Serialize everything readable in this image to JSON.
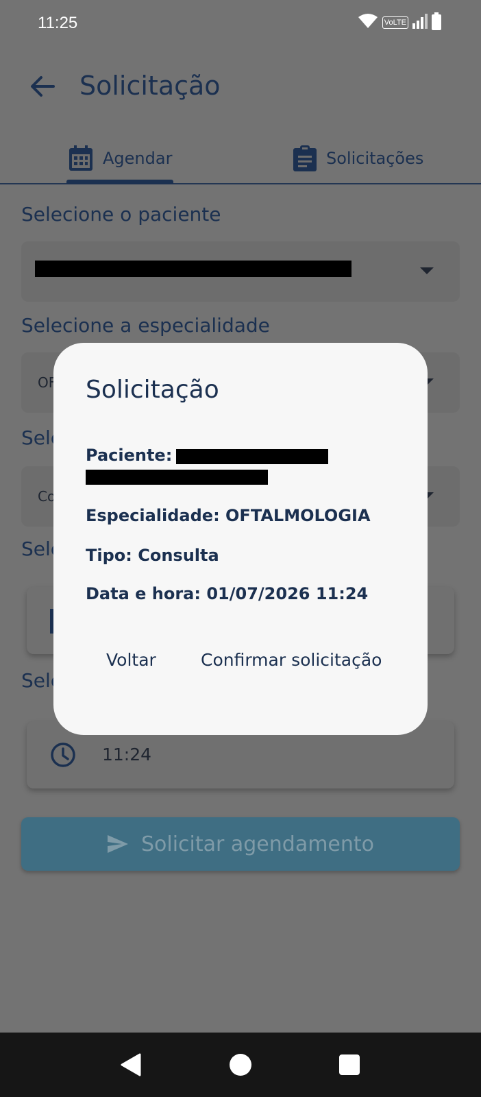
{
  "status_bar": {
    "time": "11:25",
    "volte": "VoLTE",
    "icons": [
      "wifi-icon",
      "signal-icon",
      "battery-icon"
    ]
  },
  "app_bar": {
    "title": "Solicitação",
    "back_icon": "arrow-left-icon"
  },
  "tabs": [
    {
      "label": "Agendar",
      "icon": "calendar-icon",
      "active": true
    },
    {
      "label": "Solicitações",
      "icon": "clipboard-icon",
      "active": false
    }
  ],
  "form": {
    "patient_label": "Selecione o paciente",
    "specialty_label": "Selecione a especialidade",
    "specialty_value_partial": "OF",
    "type_label_partial": "Sele",
    "type_value_partial": "Co",
    "date_label_partial": "Sele",
    "time_label_partial": "Sele",
    "time_value": "11:24",
    "submit_label": "Solicitar agendamento"
  },
  "dialog": {
    "title": "Solicitação",
    "patient_label": "Paciente:",
    "specialty_label": "Especialidade:",
    "specialty_value": "OFTALMOLOGIA",
    "type_label": "Tipo:",
    "type_value": "Consulta",
    "datetime_label": "Data e hora:",
    "datetime_value": "01/07/2026 11:24",
    "back_button": "Voltar",
    "confirm_button": "Confirmar solicitação"
  },
  "colors": {
    "primary": "#1b3050",
    "scrim": "#737373",
    "dialog_bg": "#f7f7f7",
    "submit_button_dimmed": "#3f6e83",
    "nav_bar": "#161616"
  }
}
